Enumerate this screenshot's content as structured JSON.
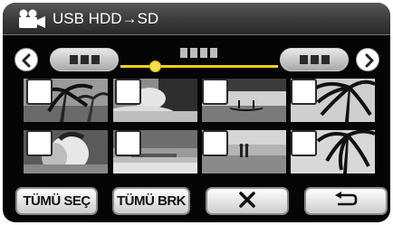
{
  "header": {
    "title": "USB HDD→SD",
    "mode_icon": "movie-camera-icon"
  },
  "navigation": {
    "prev_icon": "chevron-left-icon",
    "next_icon": "chevron-right-icon",
    "slider_position": 0.22
  },
  "thumbnails": [
    {
      "scene": "palm-trees",
      "checked": false
    },
    {
      "scene": "woman-resting",
      "checked": false
    },
    {
      "scene": "canoe-sunset",
      "checked": false
    },
    {
      "scene": "palm-silhouette",
      "checked": false
    },
    {
      "scene": "couple",
      "checked": false
    },
    {
      "scene": "beach-pier",
      "checked": false
    },
    {
      "scene": "people-shore",
      "checked": false
    },
    {
      "scene": "palm-fronds",
      "checked": false
    }
  ],
  "buttons": {
    "select_all": "TÜMÜ SEÇ",
    "deselect_all": "TÜMÜ BRK",
    "cancel_icon": "close-icon",
    "return_icon": "return-arrow-icon"
  },
  "colors": {
    "accent": "#f2d21d",
    "background": "#050505"
  }
}
